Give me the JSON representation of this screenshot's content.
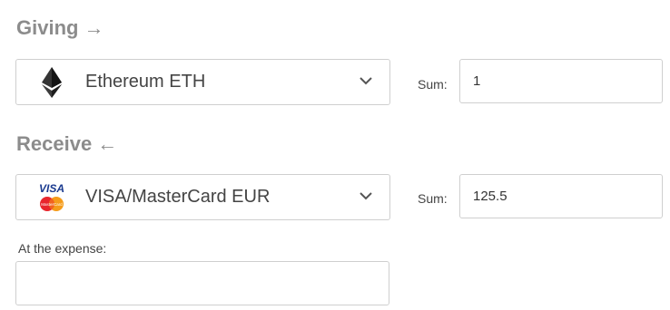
{
  "giving": {
    "title": "Giving",
    "arrow": "→",
    "currency": {
      "label": "Ethereum ETH",
      "icon": "ethereum-icon"
    },
    "sum_label": "Sum:",
    "sum_value": "1"
  },
  "receive": {
    "title": "Receive",
    "arrow": "←",
    "currency": {
      "label": "VISA/MasterCard EUR",
      "icon": "visa-mastercard-icon",
      "visa_text": "VISA",
      "mastercard_text": "MasterCard"
    },
    "sum_label": "Sum:",
    "sum_value": "125.5"
  },
  "expense": {
    "label": "At the expense:",
    "value": ""
  },
  "colors": {
    "title": "#8c8c8c",
    "border": "#cfcfcf",
    "visa_blue": "#1a3a8f",
    "mastercard_red": "#e8262d",
    "mastercard_orange": "#f59c1a"
  }
}
